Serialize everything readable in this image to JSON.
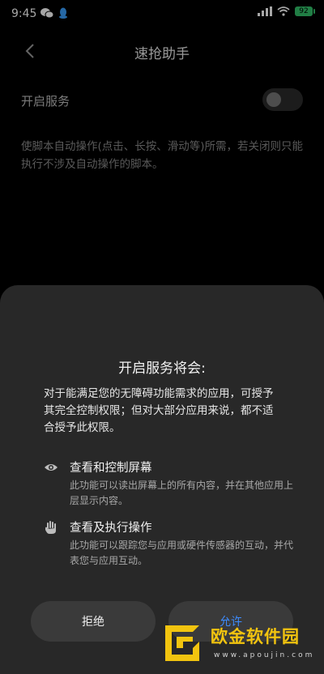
{
  "status": {
    "time": "9:45",
    "battery": "92",
    "wechat_icon": "wechat-icon",
    "qq_icon": "qq-icon",
    "signal_icon": "signal-icon",
    "wifi_icon": "wifi-icon"
  },
  "header": {
    "title": "速抢助手",
    "back_icon": "back-arrow-icon"
  },
  "settings": {
    "service_label": "开启服务",
    "service_enabled": false,
    "description": "使脚本自动操作(点击、长按、滑动等)所需，若关闭则只能执行不涉及自动操作的脚本。"
  },
  "dialog": {
    "title": "开启服务将会:",
    "body": "对于能满足您的无障碍功能需求的应用，可授予其完全控制权限；但对大部分应用来说，都不适合授予此权限。",
    "permissions": [
      {
        "icon": "eye-icon",
        "title": "查看和控制屏幕",
        "desc": "此功能可以读出屏幕上的所有内容，并在其他应用上层显示内容。"
      },
      {
        "icon": "hand-icon",
        "title": "查看及执行操作",
        "desc": "此功能可以跟踪您与应用或硬件传感器的互动，并代表您与应用互动。"
      }
    ],
    "reject_label": "拒绝",
    "allow_label": "允许",
    "accent_color": "#3d8cff"
  },
  "watermark": {
    "brand": "欧金软件园",
    "url": "www.apoujin.com"
  }
}
